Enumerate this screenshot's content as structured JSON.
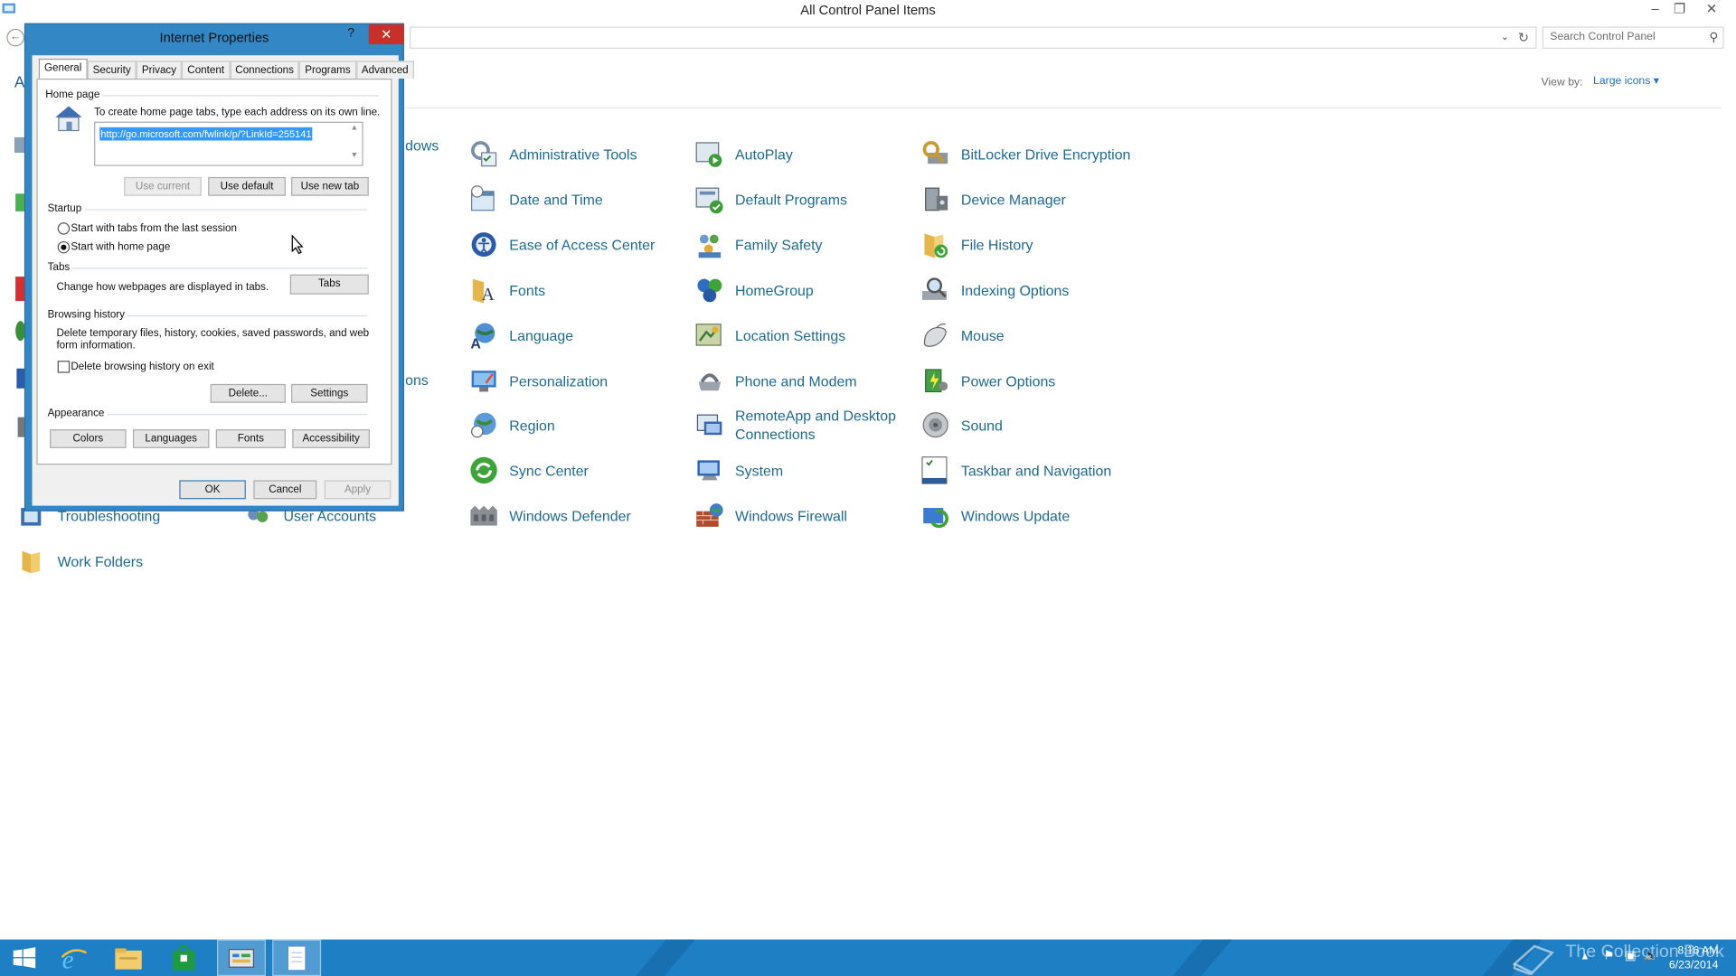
{
  "control_panel": {
    "title": "All Control Panel Items",
    "search_placeholder": "Search Control Panel",
    "view_by_label": "View by:",
    "view_by_value": "Large icons",
    "left_fragment": "A",
    "peek": {
      "windows_fragment": "dows",
      "ons_fragment": "ons",
      "troubleshooting": "Troubleshooting",
      "user_accounts": "User Accounts",
      "work_folders": "Work Folders"
    },
    "items": {
      "administrative_tools": "Administrative Tools",
      "autoplay": "AutoPlay",
      "bitlocker": "BitLocker Drive Encryption",
      "date_time": "Date and Time",
      "default_programs": "Default Programs",
      "device_manager": "Device Manager",
      "ease_of_access": "Ease of Access Center",
      "family_safety": "Family Safety",
      "file_history": "File History",
      "fonts": "Fonts",
      "homegroup": "HomeGroup",
      "indexing_options": "Indexing Options",
      "language": "Language",
      "location_settings": "Location Settings",
      "mouse": "Mouse",
      "personalization": "Personalization",
      "phone_modem": "Phone and Modem",
      "power_options": "Power Options",
      "region": "Region",
      "remoteapp_1": "RemoteApp and Desktop",
      "remoteapp_2": "Connections",
      "sound": "Sound",
      "sync_center": "Sync Center",
      "system": "System",
      "taskbar_navigation": "Taskbar and Navigation",
      "windows_defender": "Windows Defender",
      "windows_firewall": "Windows Firewall",
      "windows_update": "Windows Update"
    }
  },
  "dialog": {
    "title": "Internet Properties",
    "help": "?",
    "tabs": [
      "General",
      "Security",
      "Privacy",
      "Content",
      "Connections",
      "Programs",
      "Advanced"
    ],
    "home_page": {
      "heading": "Home page",
      "instruction": "To create home page tabs, type each address on its own line.",
      "url": "http://go.microsoft.com/fwlink/p/?LinkId=255141",
      "use_current": "Use current",
      "use_default": "Use default",
      "use_new_tab": "Use new tab"
    },
    "startup": {
      "heading": "Startup",
      "option_last_session": "Start with tabs from the last session",
      "option_home_page": "Start with home page",
      "selected": "Start with home page"
    },
    "tabs_section": {
      "heading": "Tabs",
      "description": "Change how webpages are displayed in tabs.",
      "button": "Tabs"
    },
    "browsing_history": {
      "heading": "Browsing history",
      "description_1": "Delete temporary files, history, cookies, saved passwords, and web",
      "description_2": "form information.",
      "delete_on_exit": "Delete browsing history on exit",
      "delete_on_exit_checked": false,
      "delete_button": "Delete...",
      "settings_button": "Settings"
    },
    "appearance": {
      "heading": "Appearance",
      "colors": "Colors",
      "languages": "Languages",
      "fonts": "Fonts",
      "accessibility": "Accessibility"
    },
    "ok": "OK",
    "cancel": "Cancel",
    "apply": "Apply"
  },
  "taskbar": {
    "time": "8:16 AM",
    "date": "6/23/2014",
    "watermark": "The Collection Book",
    "pinned": [
      "start-button",
      "internet-explorer",
      "file-explorer",
      "store",
      "control-panel",
      "notepad"
    ]
  },
  "colors": {
    "link_text": "#1e6a8f",
    "dialog_frame": "#3487c5",
    "close_button": "#c7312a",
    "taskbar": "#1f7fc4",
    "selection": "#3399ff"
  }
}
